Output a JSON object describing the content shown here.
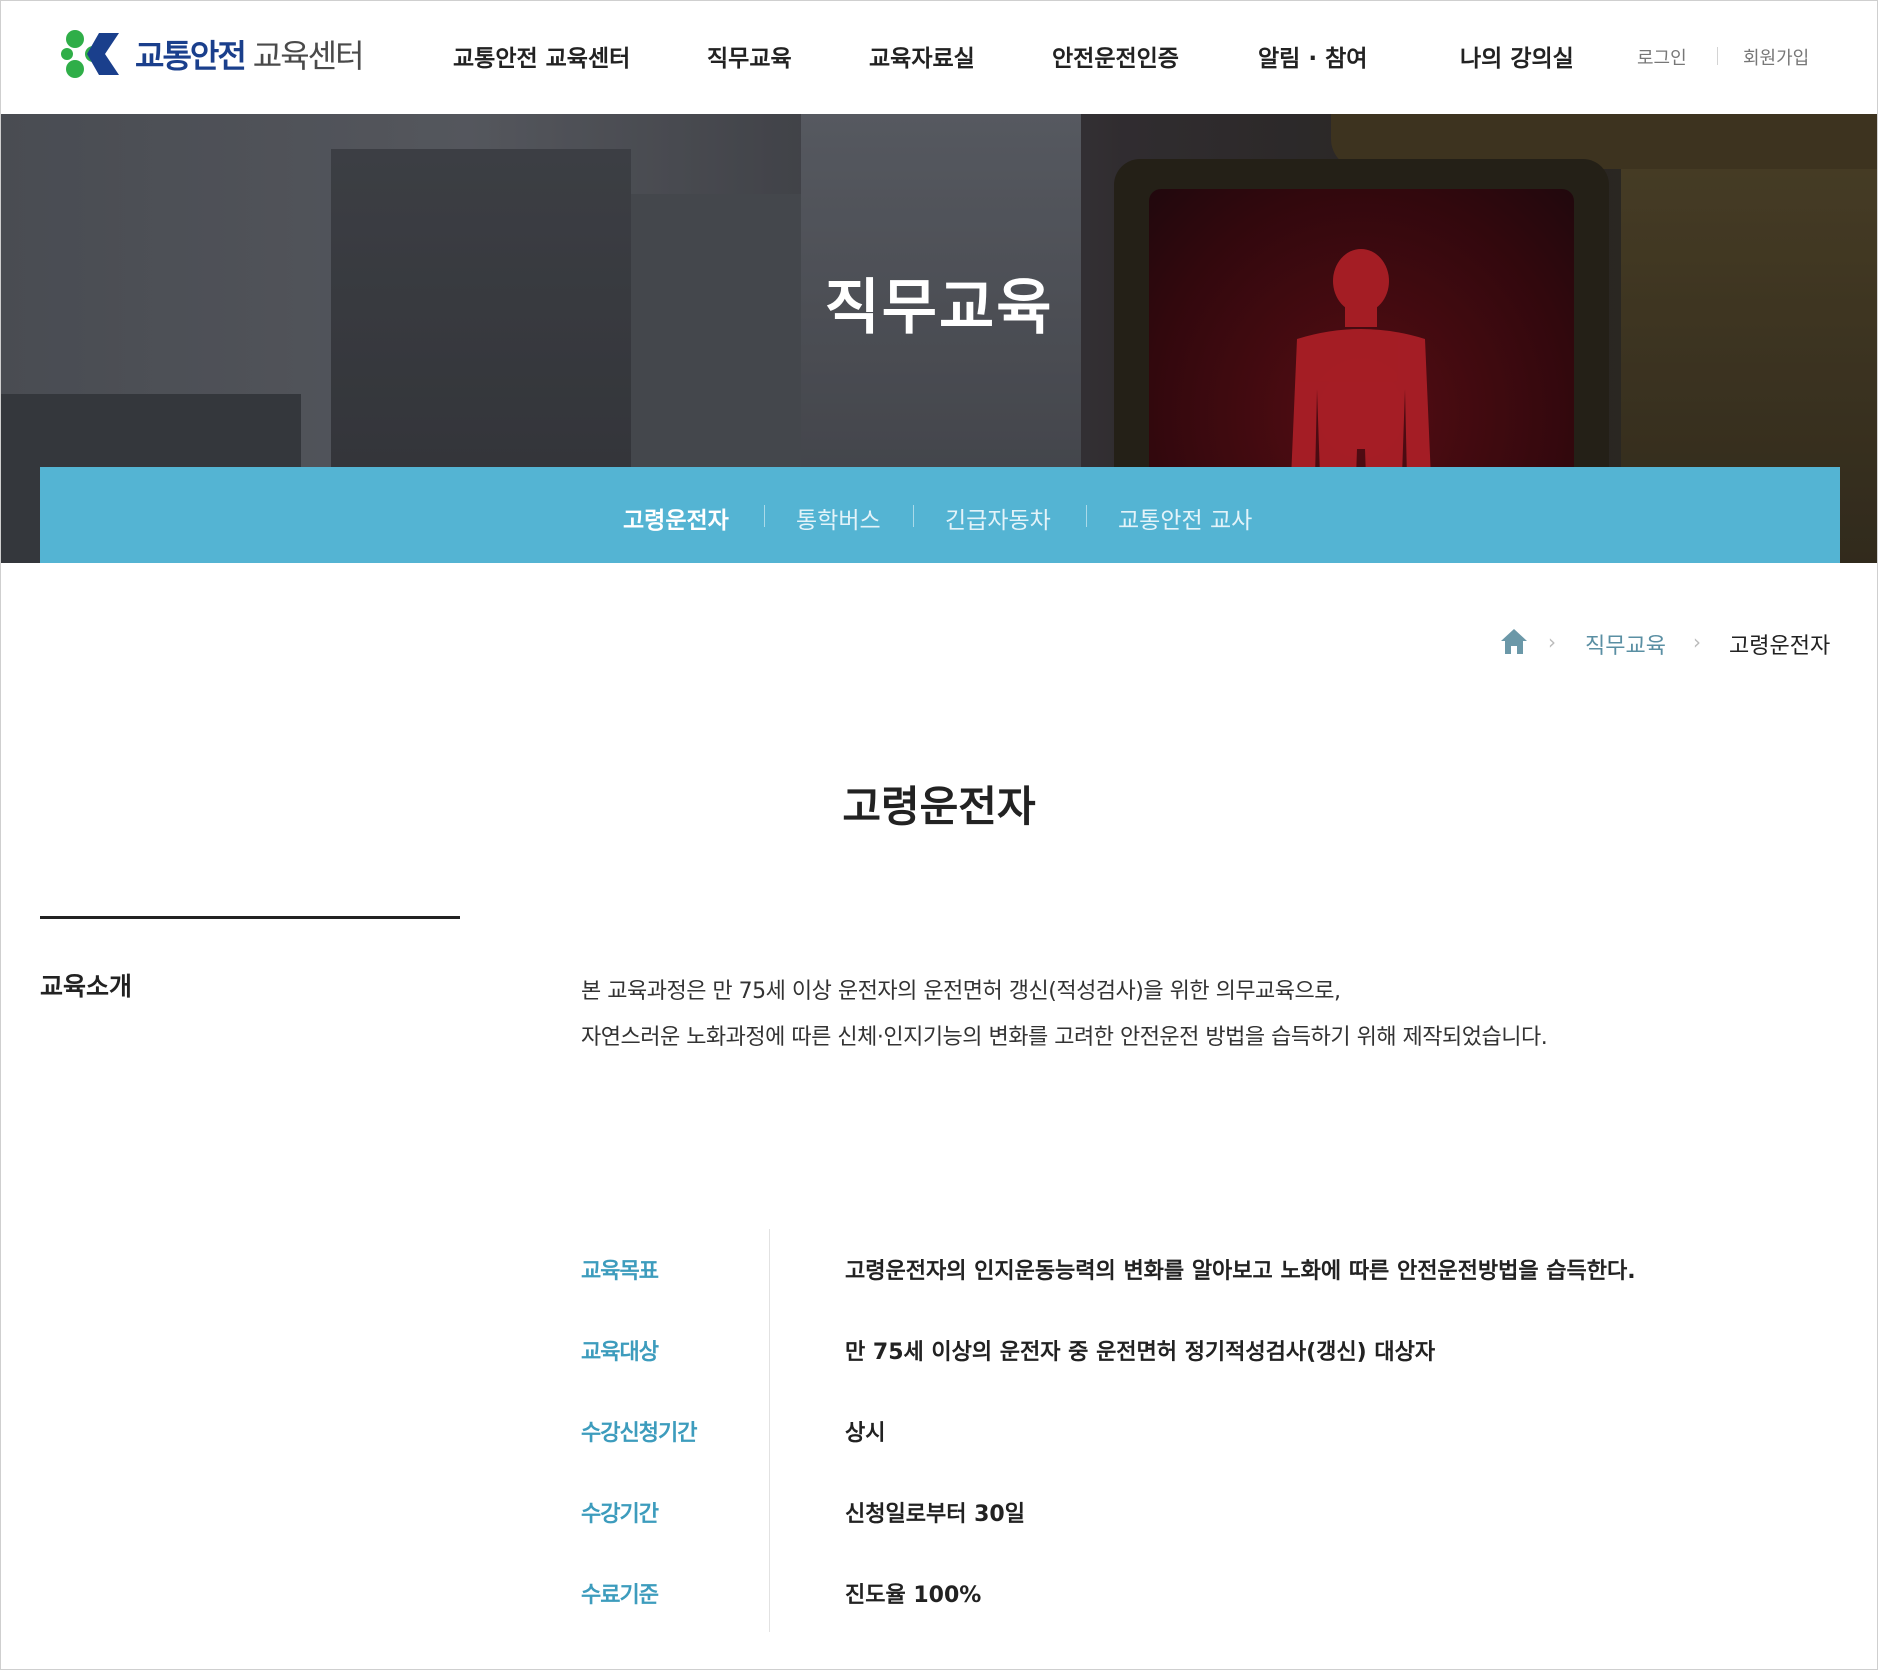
{
  "header": {
    "logo": {
      "bold": "교통안전",
      "light": "교육센터"
    },
    "nav": [
      "교통안전 교육센터",
      "직무교육",
      "교육자료실",
      "안전운전인증",
      "알림 · 참여",
      "나의 강의실"
    ],
    "util": {
      "login": "로그인",
      "signup": "회원가입"
    }
  },
  "hero": {
    "title": "직무교육",
    "subnav": [
      "고령운전자",
      "통학버스",
      "긴급자동차",
      "교통안전 교사"
    ],
    "active_index": 0
  },
  "breadcrumb": {
    "home_icon": "home-icon",
    "items": [
      "직무교육",
      "고령운전자"
    ]
  },
  "page_title": "고령운전자",
  "intro": {
    "title": "교육소개",
    "lines": [
      "본 교육과정은 만 75세 이상 운전자의 운전면허 갱신(적성검사)을 위한 의무교육으로,",
      "자연스러운 노화과정에 따른 신체·인지기능의 변화를 고려한 안전운전 방법을 습득하기 위해 제작되었습니다."
    ]
  },
  "info": [
    {
      "label": "교육목표",
      "value": "고령운전자의 인지운동능력의 변화를 알아보고 노화에 따른 안전운전방법을 습득한다."
    },
    {
      "label": "교육대상",
      "value": "만 75세 이상의 운전자 중 운전면허 정기적성검사(갱신) 대상자"
    },
    {
      "label": "수강신청기간",
      "value": "상시"
    },
    {
      "label": "수강기간",
      "value": "신청일로부터 30일"
    },
    {
      "label": "수료기준",
      "value": "진도율 100%"
    }
  ],
  "colors": {
    "accent": "#54b4d3",
    "label": "#3d9cbd",
    "logo_blue": "#1a3f8c",
    "logo_green": "#2fae48"
  }
}
